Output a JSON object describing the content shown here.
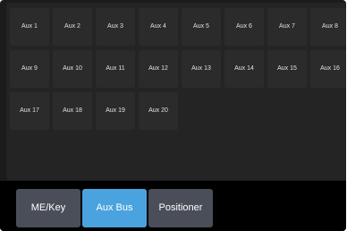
{
  "aux_buttons": [
    {
      "label": "Aux 1"
    },
    {
      "label": "Aux 2"
    },
    {
      "label": "Aux 3"
    },
    {
      "label": "Aux 4"
    },
    {
      "label": "Aux 5"
    },
    {
      "label": "Aux 6"
    },
    {
      "label": "Aux 7"
    },
    {
      "label": "Aux 8"
    },
    {
      "label": "Aux 9"
    },
    {
      "label": "Aux 10"
    },
    {
      "label": "Aux 11"
    },
    {
      "label": "Aux 12"
    },
    {
      "label": "Aux 13"
    },
    {
      "label": "Aux 14"
    },
    {
      "label": "Aux 15"
    },
    {
      "label": "Aux 16"
    },
    {
      "label": "Aux 17"
    },
    {
      "label": "Aux 18"
    },
    {
      "label": "Aux 19"
    },
    {
      "label": "Aux 20"
    }
  ],
  "tabs": [
    {
      "label": "ME/Key",
      "active": false
    },
    {
      "label": "Aux Bus",
      "active": true
    },
    {
      "label": "Positioner",
      "active": false
    }
  ],
  "colors": {
    "background": "#1b1b1b",
    "panel": "#242424",
    "button": "#2b2b2b",
    "tab_inactive": "#4a4e58",
    "tab_active": "#4aa3df",
    "tab_bar": "#000000"
  }
}
